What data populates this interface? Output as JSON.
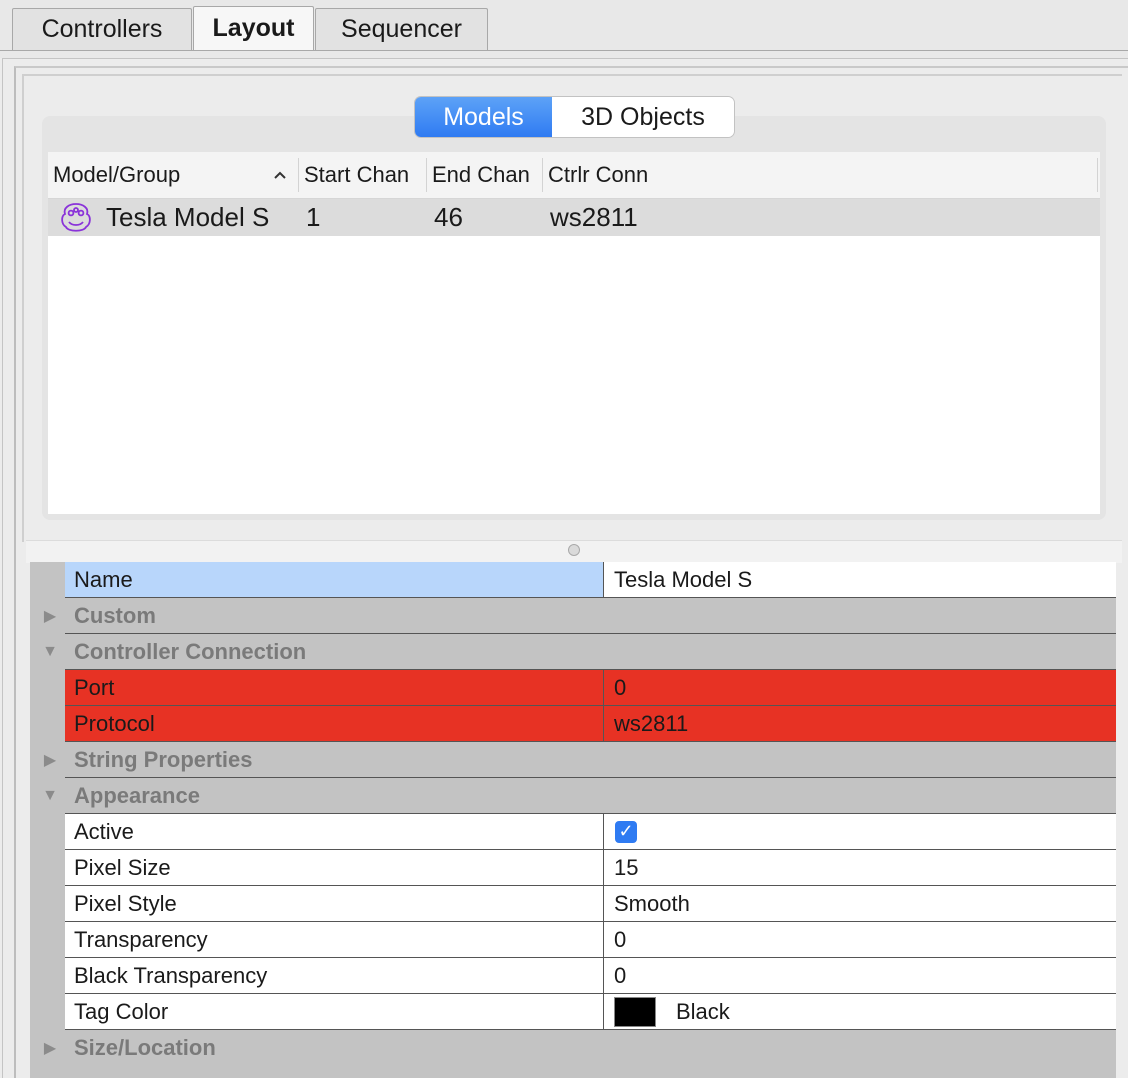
{
  "tabs": [
    {
      "label": "Controllers",
      "active": false
    },
    {
      "label": "Layout",
      "active": true
    },
    {
      "label": "Sequencer",
      "active": false
    }
  ],
  "segment": {
    "models": "Models",
    "objects": "3D Objects",
    "selected": "Models"
  },
  "list": {
    "headers": {
      "model": "Model/Group",
      "start": "Start Chan",
      "end": "End Chan",
      "conn": "Ctrlr Conn"
    },
    "sort_icon": "chevron-up-icon",
    "rows": [
      {
        "icon": "model-face-icon",
        "name": "Tesla Model S",
        "start": "1",
        "end": "46",
        "conn": "ws2811"
      }
    ]
  },
  "properties": {
    "name": {
      "label": "Name",
      "value": "Tesla Model S"
    },
    "custom": {
      "label": "Custom",
      "expanded": false
    },
    "controller_connection": {
      "label": "Controller Connection",
      "expanded": true
    },
    "port": {
      "label": "Port",
      "value": "0"
    },
    "protocol": {
      "label": "Protocol",
      "value": "ws2811"
    },
    "string_properties": {
      "label": "String Properties",
      "expanded": false
    },
    "appearance": {
      "label": "Appearance",
      "expanded": true
    },
    "active": {
      "label": "Active",
      "checked": true
    },
    "pixel_size": {
      "label": "Pixel Size",
      "value": "15"
    },
    "pixel_style": {
      "label": "Pixel Style",
      "value": "Smooth"
    },
    "transparency": {
      "label": "Transparency",
      "value": "0"
    },
    "black_transparency": {
      "label": "Black Transparency",
      "value": "0"
    },
    "tag_color": {
      "label": "Tag Color",
      "value": "Black",
      "color": "#000000"
    },
    "size_location": {
      "label": "Size/Location",
      "expanded": false
    }
  },
  "colors": {
    "accent": "#2f7bf2",
    "error_row": "#e73224",
    "selected_name": "#b8d6fb"
  }
}
